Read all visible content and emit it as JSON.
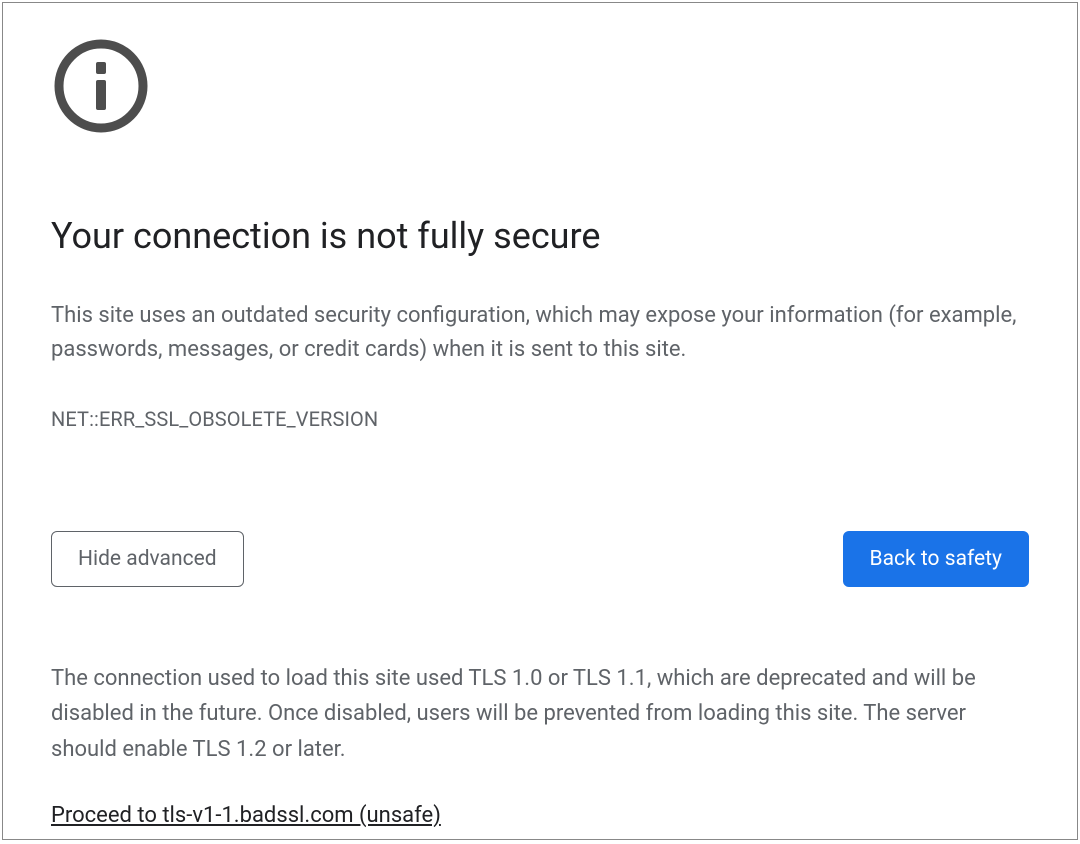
{
  "icon": "info-icon",
  "title": "Your connection is not fully secure",
  "body": "This site uses an outdated security configuration, which may expose your information (for example, passwords, messages, or credit cards) when it is sent to this site.",
  "error_code": "NET::ERR_SSL_OBSOLETE_VERSION",
  "buttons": {
    "hide_advanced": "Hide advanced",
    "back_to_safety": "Back to safety"
  },
  "advanced": {
    "explanation": "The connection used to load this site used TLS 1.0 or TLS 1.1, which are deprecated and will be disabled in the future. Once disabled, users will be prevented from loading this site. The server should enable TLS 1.2 or later.",
    "proceed_link": "Proceed to tls-v1-1.badssl.com (unsafe)"
  },
  "colors": {
    "primary_button": "#1a73e8",
    "text_primary": "#202124",
    "text_secondary": "#5f6368",
    "icon": "#4d4d4d"
  }
}
